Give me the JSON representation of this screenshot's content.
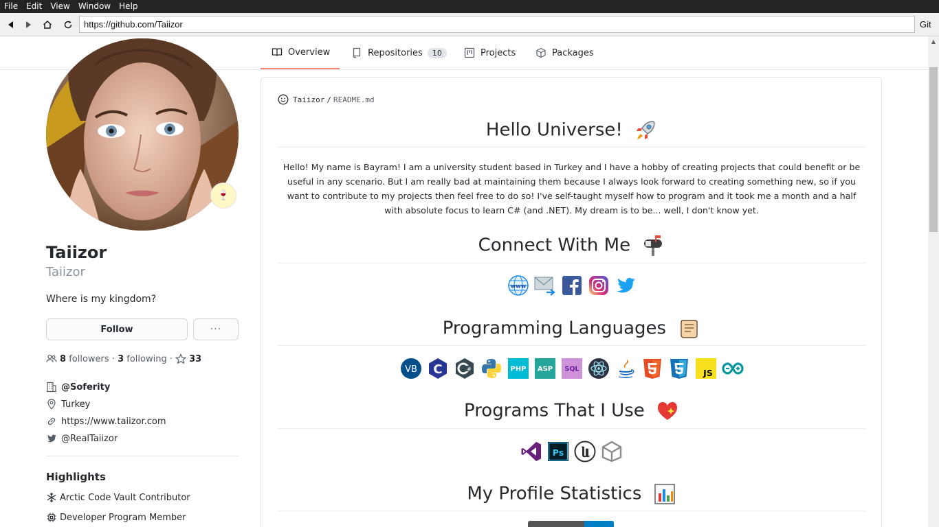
{
  "menubar": {
    "items": [
      "File",
      "Edit",
      "View",
      "Window",
      "Help"
    ]
  },
  "addressbar": {
    "url": "https://github.com/Taiizor",
    "git_label": "Git"
  },
  "tabs": [
    {
      "label": "Overview",
      "icon": "book-icon",
      "selected": true
    },
    {
      "label": "Repositories",
      "icon": "repo-icon",
      "count": "10"
    },
    {
      "label": "Projects",
      "icon": "project-icon"
    },
    {
      "label": "Packages",
      "icon": "package-icon"
    }
  ],
  "profile": {
    "name": "Taiizor",
    "login": "Taiizor",
    "bio": "Where is my kingdom?",
    "follow_label": "Follow",
    "more_label": "···",
    "followers_count": "8",
    "followers_label": "followers",
    "following_count": "3",
    "following_label": "following",
    "stars_count": "33",
    "sep": "·",
    "org": "@Soferity",
    "location": "Turkey",
    "website": "https://www.taiizor.com",
    "twitter": "@RealTaiizor",
    "highlights_title": "Highlights",
    "highlights": [
      "Arctic Code Vault Contributor",
      "Developer Program Member"
    ]
  },
  "readme": {
    "owner": "Taiizor",
    "slash": "/",
    "file": "README.md",
    "h_hello": "Hello Universe!",
    "intro": "Hello! My name is Bayram! I am a university student based in Turkey and I have a hobby of creating projects that could benefit or be useful in any scenario. But I am really bad at maintaining them because I always look forward to creating something new, so if you want to contribute to my projects then feel free to do so! I've self-taught myself how to program and it took me a month and a half with absolute focus to learn C# (and .NET). My dream is to be... well, I don't know yet.",
    "h_connect": "Connect With Me",
    "connect_icons": [
      "www-icon",
      "email-icon",
      "facebook-icon",
      "instagram-icon",
      "twitter-icon"
    ],
    "h_languages": "Programming Languages",
    "language_icons": [
      {
        "name": "vb-icon",
        "text": "VB",
        "color": "#004e8c"
      },
      {
        "name": "c-icon",
        "text": "C",
        "color": "#283593"
      },
      {
        "name": "csharp-icon",
        "text": "C#",
        "color": "#37474f"
      },
      {
        "name": "python-icon",
        "text": "",
        "color": "#3776ab"
      },
      {
        "name": "php-icon",
        "text": "PHP",
        "color": "#00bcd4"
      },
      {
        "name": "asp-icon",
        "text": "ASP",
        "color": "#26a69a"
      },
      {
        "name": "sql-icon",
        "text": "SQL",
        "color": "#ce93d8"
      },
      {
        "name": "electron-icon",
        "text": "",
        "color": "#2f3242"
      },
      {
        "name": "java-icon",
        "text": "",
        "color": "#e76f00"
      },
      {
        "name": "html5-icon",
        "text": "5",
        "color": "#e44d26"
      },
      {
        "name": "css3-icon",
        "text": "3",
        "color": "#1572b6"
      },
      {
        "name": "javascript-icon",
        "text": "JS",
        "color": "#f7df1e"
      },
      {
        "name": "arduino-icon",
        "text": "",
        "color": "#00979d"
      }
    ],
    "h_programs": "Programs That I Use",
    "program_icons": [
      "visual-studio-icon",
      "photoshop-icon",
      "unreal-engine-icon",
      "unity-icon"
    ],
    "h_stats": "My Profile Statistics"
  },
  "colors": {
    "accent": "#f9826c",
    "link": "#0366d6",
    "text": "#24292e",
    "muted": "#586069"
  }
}
